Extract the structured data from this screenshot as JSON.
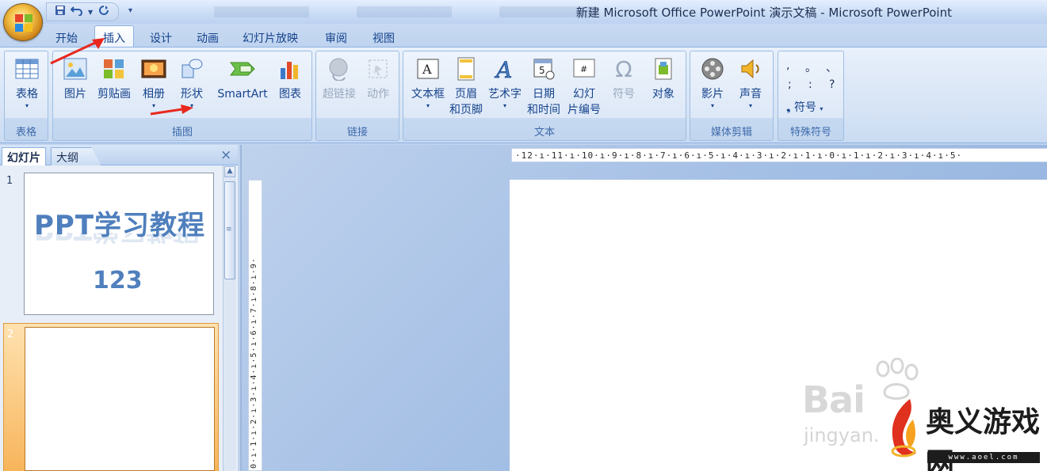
{
  "window": {
    "title": "新建 Microsoft Office PowerPoint 演示文稿 - Microsoft PowerPoint"
  },
  "quick_access": {
    "save_icon": "save-icon",
    "undo_icon": "undo-icon",
    "redo_icon": "redo-icon",
    "customize_icon": "dropdown-icon"
  },
  "tabs": [
    {
      "label": "开始"
    },
    {
      "label": "插入"
    },
    {
      "label": "设计"
    },
    {
      "label": "动画"
    },
    {
      "label": "幻灯片放映"
    },
    {
      "label": "审阅"
    },
    {
      "label": "视图"
    }
  ],
  "active_tab": "插入",
  "ribbon": {
    "groups": {
      "tables": "表格",
      "illustrations": "插图",
      "links": "链接",
      "text": "文本",
      "media": "媒体剪辑",
      "symbols": "特殊符号"
    },
    "buttons": {
      "table": "表格",
      "picture": "图片",
      "clipart": "剪贴画",
      "album": "相册",
      "shapes": "形状",
      "smartart": "SmartArt",
      "chart": "图表",
      "hyperlink": "超链接",
      "action": "动作",
      "textbox": "文本框",
      "header_footer_1": "页眉",
      "header_footer_2": "和页脚",
      "wordart": "艺术字",
      "datetime_1": "日期",
      "datetime_2": "和时间",
      "slide_number_1": "幻灯",
      "slide_number_2": "片编号",
      "symbol": "符号",
      "object": "对象",
      "movie": "影片",
      "sound": "声音",
      "special_symbol": "符号"
    },
    "special_chars": [
      ",",
      "。",
      "、",
      ";",
      ":",
      "?"
    ],
    "special_char_bullet": "❟"
  },
  "panel": {
    "tab_slides": "幻灯片",
    "tab_outline": "大纲",
    "close": "×"
  },
  "slides": [
    {
      "number": "1",
      "title": "PPT学习教程",
      "subtitle": "123"
    },
    {
      "number": "2",
      "title": "",
      "subtitle": ""
    }
  ],
  "rulers": {
    "horizontal": "·12·ı·11·ı·10·ı·9·ı·8·ı·7·ı·6·ı·5·ı·4·ı·3·ı·2·ı·1·ı·0·ı·1·ı·2·ı·3·ı·4·ı·5·",
    "vertical": "0·ı·1·ı·2·ı·3·ı·4·ı·5·ı·6·ı·7·ı·8·ı·9·"
  },
  "watermarks": {
    "baidu": "Bai",
    "jingyan": "jingyan.",
    "aoyi": "奥义游戏网",
    "url": "www.aoel.com"
  },
  "colors": {
    "ribbon_text": "#15428b",
    "slide_text": "#4f7fbd",
    "annotation_arrow": "#e8281e",
    "selected_slide": "#f7b45a"
  }
}
